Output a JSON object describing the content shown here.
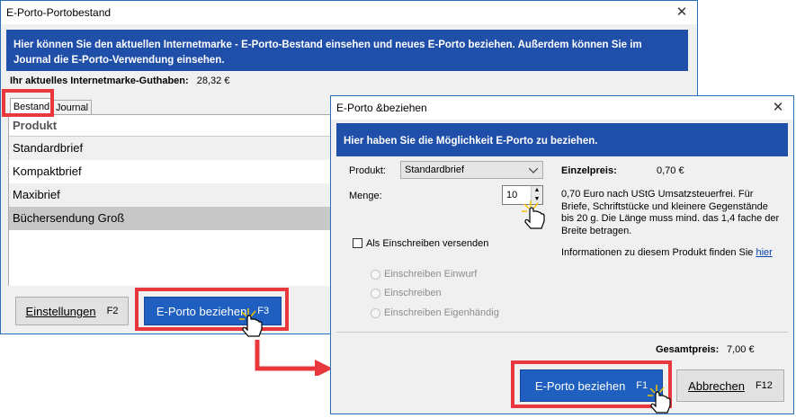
{
  "bestand_window": {
    "title": "E-Porto-Portobestand",
    "banner_text": "Hier können Sie den aktuellen Internetmarke - E-Porto-Bestand einsehen und neues E-Porto beziehen. Außerdem können Sie im Journal die E-Porto-Verwendung einsehen.",
    "guthaben_label": "Ihr aktuelles Internetmarke-Guthaben:",
    "guthaben_value": "28,32 €",
    "tabs": [
      "Bestand",
      "Journal"
    ],
    "column_header": "Produkt",
    "products": [
      "Standardbrief",
      "Kompaktbrief",
      "Maxibrief",
      "Büchersendung Groß"
    ],
    "settings_button": "Einstellungen",
    "settings_key": "F2",
    "buy_button": "E-Porto beziehen",
    "buy_key": "F3"
  },
  "beziehen_window": {
    "title": "E-Porto &beziehen",
    "banner_text": "Hier haben Sie die Möglichkeit E-Porto zu beziehen.",
    "produkt_label": "Produkt:",
    "produkt_value": "Standardbrief",
    "menge_label": "Menge:",
    "menge_value": "10",
    "einzelpreis_label": "Einzelpreis:",
    "einzelpreis_value": "0,70 €",
    "description_lines": [
      "0,70 Euro nach UStG Umsatzsteuerfrei. Für",
      "Briefe, Schriftstücke und kleinere Gegenstände",
      "bis 20 g. Die Länge muss mind. das 1,4 fache der",
      "Breite betragen."
    ],
    "info_text": "Informationen zu diesem Produkt finden Sie",
    "info_link": "hier",
    "einschreiben_checkbox": "Als Einschreiben versenden",
    "radio_options": [
      "Einschreiben Einwurf",
      "Einschreiben",
      "Einschreiben Eigenhändig"
    ],
    "gesamtpreis_label": "Gesamtpreis:",
    "gesamtpreis_value": "7,00 €",
    "buy_button": "E-Porto beziehen",
    "buy_key": "F1",
    "cancel_button": "Abbrechen",
    "cancel_key": "F12"
  },
  "colors": {
    "banner": "#1f4fa8",
    "primary_button": "#1f5fbf",
    "highlight_frame": "#e8383d",
    "selected_row": "#c8c8c8"
  }
}
